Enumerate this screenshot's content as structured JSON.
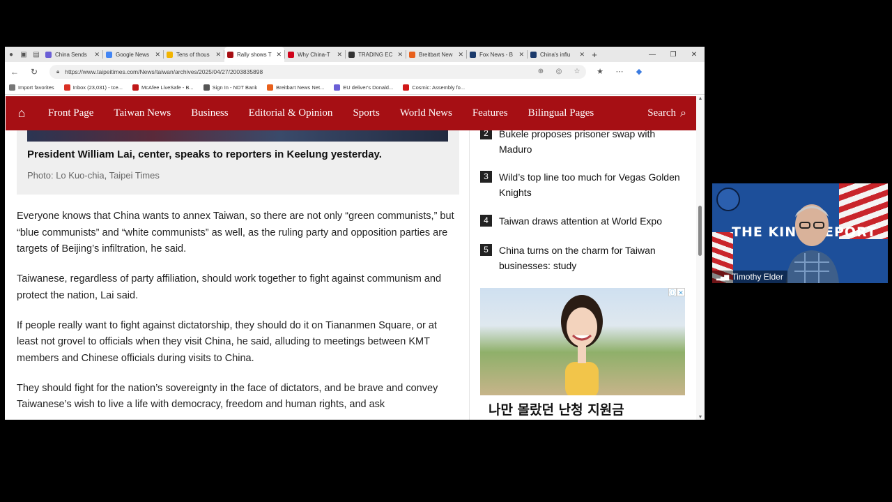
{
  "browser": {
    "tabs": [
      {
        "title": "China Sends",
        "color": "#6b5fd6",
        "active": false
      },
      {
        "title": "Google News",
        "color": "#4285f4",
        "active": false
      },
      {
        "title": "Tens of thous",
        "color": "#f2b400",
        "active": false
      },
      {
        "title": "Rally shows T",
        "color": "#a60f14",
        "active": true
      },
      {
        "title": "Why China-T",
        "color": "#d0021b",
        "active": false
      },
      {
        "title": "TRADING EC",
        "color": "#333333",
        "active": false
      },
      {
        "title": "Breitbart New",
        "color": "#e8601c",
        "active": false
      },
      {
        "title": "Fox News - B",
        "color": "#1b3a6b",
        "active": false
      },
      {
        "title": "China's influ",
        "color": "#1b3a6b",
        "active": false
      }
    ],
    "url": "https://www.taipeitimes.com/News/taiwan/archives/2025/04/27/2003835898",
    "favorites": [
      {
        "label": "Import favorites",
        "color": "#777777"
      },
      {
        "label": "Inbox (23,031) - tce...",
        "color": "#d93025"
      },
      {
        "label": "McAfee LiveSafe - B...",
        "color": "#c01818"
      },
      {
        "label": "Sign In - NDT Bank",
        "color": "#555555"
      },
      {
        "label": "Breitbart News Net...",
        "color": "#e8601c"
      },
      {
        "label": "EU deliver's Donald...",
        "color": "#6b5fd6"
      },
      {
        "label": "Cosmic: Assembly fo...",
        "color": "#d01818"
      }
    ]
  },
  "site": {
    "nav": [
      "Front Page",
      "Taiwan News",
      "Business",
      "Editorial & Opinion",
      "Sports",
      "World News",
      "Features",
      "Bilingual Pages"
    ],
    "search_label": "Search",
    "brand_color": "#a60f14"
  },
  "article": {
    "caption": "President William Lai, center, speaks to reporters in Keelung yesterday.",
    "photo_credit": "Photo: Lo Kuo-chia, Taipei Times",
    "paragraphs": [
      "Everyone knows that China wants to annex Taiwan, so there are not only “green communists,” but “blue communists” and “white communists” as well, as the ruling party and opposition parties are targets of Beijing’s infiltration, he said.",
      "Taiwanese, regardless of party affiliation, should work together to fight against communism and protect the nation, Lai said.",
      "If people really want to fight against dictatorship, they should do it on Tiananmen Square, or at least not grovel to officials when they visit China, he said, alluding to meetings between KMT members and Chinese officials during visits to China.",
      "They should fight for the nation’s sovereignty in the face of dictators, and be brave and convey Taiwanese’s wish to live a life with democracy, freedom and human rights, and ask"
    ]
  },
  "popular": [
    {
      "rank": "2",
      "title": "Bukele proposes prisoner swap with Maduro"
    },
    {
      "rank": "3",
      "title": "Wild’s top line too much for Vegas Golden Knights"
    },
    {
      "rank": "4",
      "title": "Taiwan draws attention at World Expo"
    },
    {
      "rank": "5",
      "title": "China turns on the charm for Taiwan businesses: study"
    }
  ],
  "ad": {
    "headline": "나만 몰랐던 난청 지원금"
  },
  "webcam": {
    "title": "THE KING REPORT",
    "name": "Timothy Elder"
  }
}
